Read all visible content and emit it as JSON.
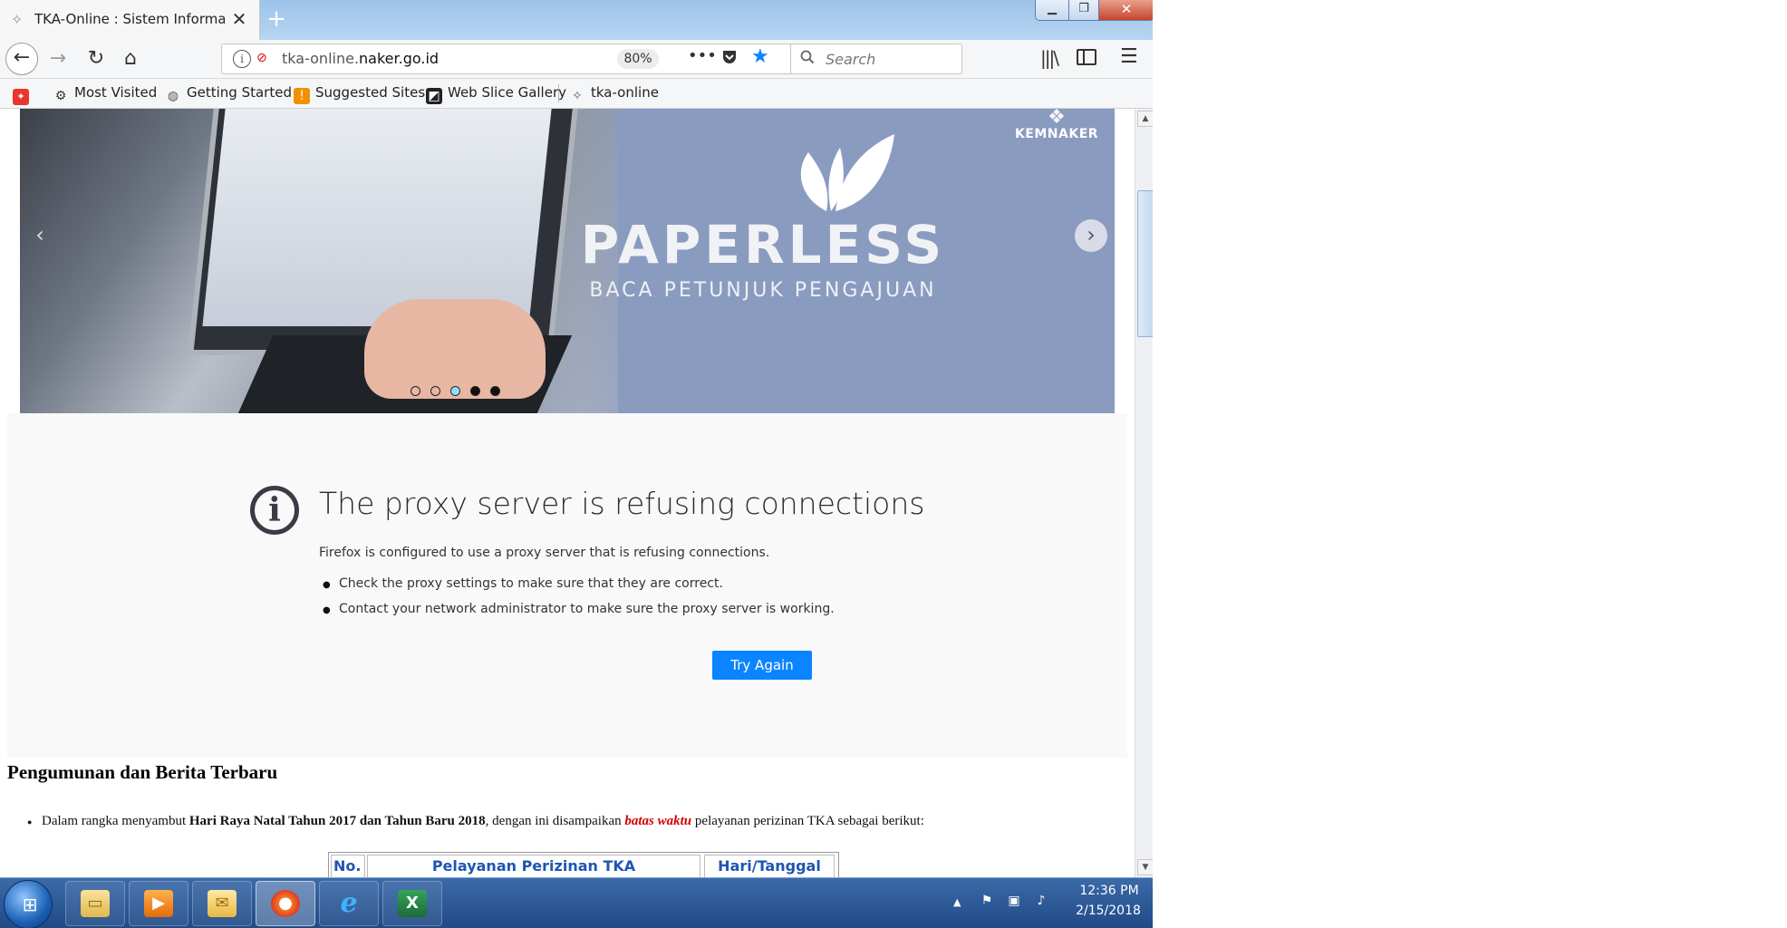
{
  "window": {
    "tab_title": "TKA-Online : Sistem Informasi P",
    "tab_close": "✕",
    "new_tab": "+",
    "min_label": "▁",
    "max_label": "❐",
    "close_label": "✕"
  },
  "nav": {
    "back": "←",
    "forward": "→",
    "reload": "↻",
    "home": "⌂",
    "url_prefix": "tka-online.",
    "url_domain": "naker.go.id",
    "zoom": "80%",
    "page_actions": "•••",
    "search_placeholder": "Search",
    "menu": "☰"
  },
  "bookmarks": {
    "items": [
      {
        "label": ""
      },
      {
        "label": "Most Visited"
      },
      {
        "label": "Getting Started"
      },
      {
        "label": "Suggested Sites"
      },
      {
        "label": "Web Slice Gallery"
      },
      {
        "label": "tka-online"
      }
    ]
  },
  "banner": {
    "logo_text": "KEMNAKER",
    "heading": "PAPERLESS",
    "subheading": "BACA PETUNJUK PENGAJUAN",
    "prev": "‹",
    "next": "›",
    "dots": 5,
    "active_dot": 3
  },
  "error": {
    "title": "The proxy server is refusing connections",
    "description": "Firefox is configured to use a proxy server that is refusing connections.",
    "bullets": [
      "Check the proxy settings to make sure that they are correct.",
      "Contact your network administrator to make sure the proxy server is working."
    ],
    "try_again": "Try Again"
  },
  "announcements": {
    "heading": "Pengumunan dan Berita Terbaru",
    "item": {
      "t1": "Dalam rangka menyambut ",
      "t2": "Hari Raya Natal Tahun 2017 dan Tahun Baru 2018",
      "t3": ", dengan ini disampaikan ",
      "t4": "batas waktu",
      "t5": " pelayanan perizinan TKA sebagai berikut:"
    },
    "table_headers": [
      "No.",
      "Pelayanan Perizinan TKA",
      "Hari/Tanggal"
    ]
  },
  "taskbar": {
    "tray_arrow": "▲",
    "time": "12:36 PM",
    "date": "2/15/2018"
  },
  "colors": {
    "accent": "#0a84ff",
    "banner_bg": "#8a9bc0",
    "error_bg": "#f9f9fa",
    "highlight_red": "#d40000",
    "table_header": "#1e55b3"
  }
}
